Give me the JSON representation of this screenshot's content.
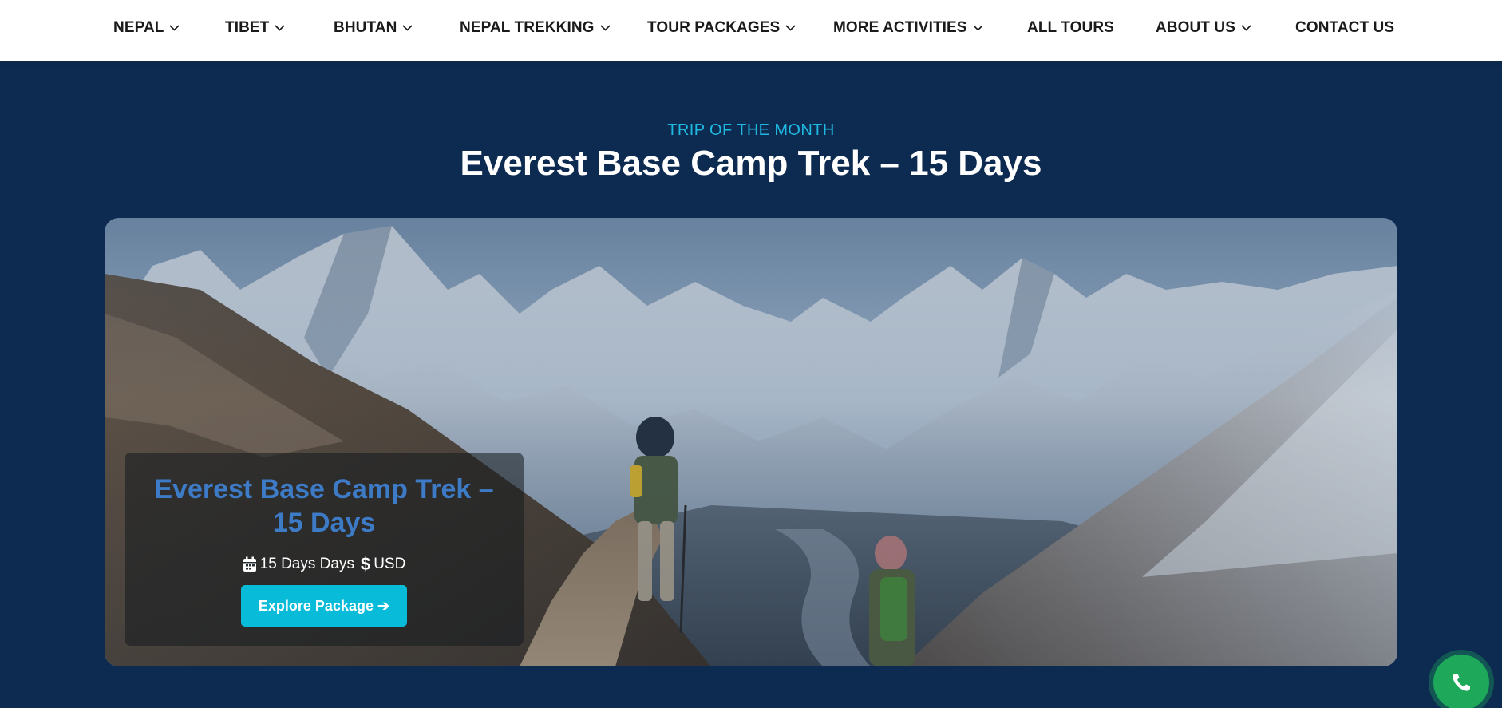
{
  "nav": {
    "items": [
      {
        "label": "NEPAL",
        "dropdown": true
      },
      {
        "label": "TIBET",
        "dropdown": true
      },
      {
        "label": "BHUTAN",
        "dropdown": true
      },
      {
        "label": "NEPAL TREKKING",
        "dropdown": true
      },
      {
        "label": "TOUR PACKAGES",
        "dropdown": true
      },
      {
        "label": "MORE ACTIVITIES",
        "dropdown": true
      },
      {
        "label": "ALL TOURS",
        "dropdown": false
      },
      {
        "label": "ABOUT US",
        "dropdown": true
      },
      {
        "label": "CONTACT US",
        "dropdown": false
      }
    ]
  },
  "section": {
    "eyebrow": "TRIP OF THE MONTH",
    "headline": "Everest Base Camp Trek – 15 Days"
  },
  "card": {
    "title": "Everest Base Camp Trek – 15 Days",
    "duration": "15 Days Days",
    "price": "USD",
    "button_label": "Explore Package ➔",
    "icons": {
      "duration": "calendar-icon",
      "price": "dollar-icon"
    }
  },
  "floating": {
    "call_icon": "phone-icon"
  },
  "colors": {
    "nav_bg": "#ffffff",
    "section_bg": "#0d2b50",
    "eyebrow": "#1fb8e0",
    "card_title": "#3d7bc6",
    "button": "#08bcd9",
    "call_button": "#1ea85a"
  }
}
